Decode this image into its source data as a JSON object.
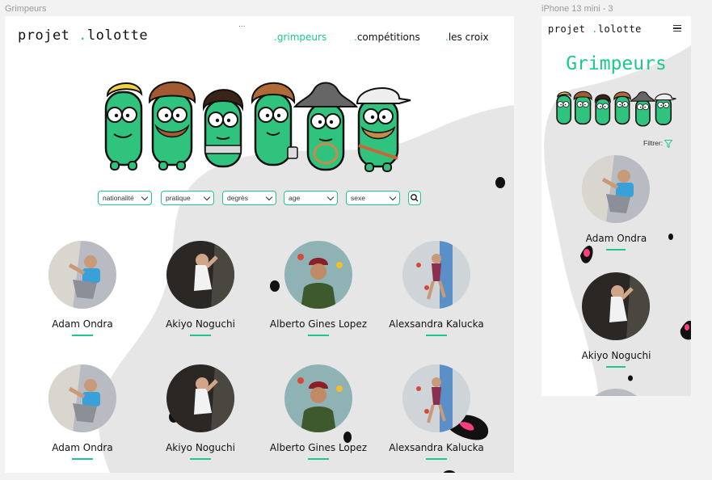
{
  "canvas": {
    "desktop_frame_label": "Grimpeurs",
    "mobile_frame_label": "iPhone 13 mini - 3"
  },
  "desktop": {
    "logo": {
      "part1": "projet",
      "dot": ".",
      "part2": "lolotte"
    },
    "nav": [
      {
        "dot": ".",
        "label": "grimpeurs"
      },
      {
        "dot": ".",
        "label": "compétitions"
      },
      {
        "dot": ".",
        "label": "les croix"
      }
    ],
    "tiny_text": "...",
    "filters": [
      {
        "label": "nationalité"
      },
      {
        "label": "pratique"
      },
      {
        "label": "degrès"
      },
      {
        "label": "age"
      },
      {
        "label": "sexe"
      }
    ],
    "search_icon": "search-icon",
    "climbers": [
      {
        "name": "Adam Ondra"
      },
      {
        "name": "Akiyo Noguchi"
      },
      {
        "name": "Alberto Gines Lopez"
      },
      {
        "name": "Alexsandra Kalucka"
      },
      {
        "name": "Adam Ondra"
      },
      {
        "name": "Akiyo Noguchi"
      },
      {
        "name": "Alberto Gines Lopez"
      },
      {
        "name": "Alexsandra Kalucka"
      }
    ]
  },
  "mobile": {
    "logo": {
      "part1": "projet",
      "dot": ".",
      "part2": "lolotte"
    },
    "menu_icon": "hamburger-icon",
    "title": "Grimpeurs",
    "filter_label": "Filtrer:",
    "filter_icon": "funnel-icon",
    "climbers": [
      {
        "name": "Adam Ondra"
      },
      {
        "name": "Akiyo Noguchi"
      }
    ]
  },
  "colors": {
    "accent": "#1cc88a",
    "background_blob": "#e6e6e6",
    "mascot_green": "#2fc37d",
    "blob_pink": "#ff3d7f"
  }
}
